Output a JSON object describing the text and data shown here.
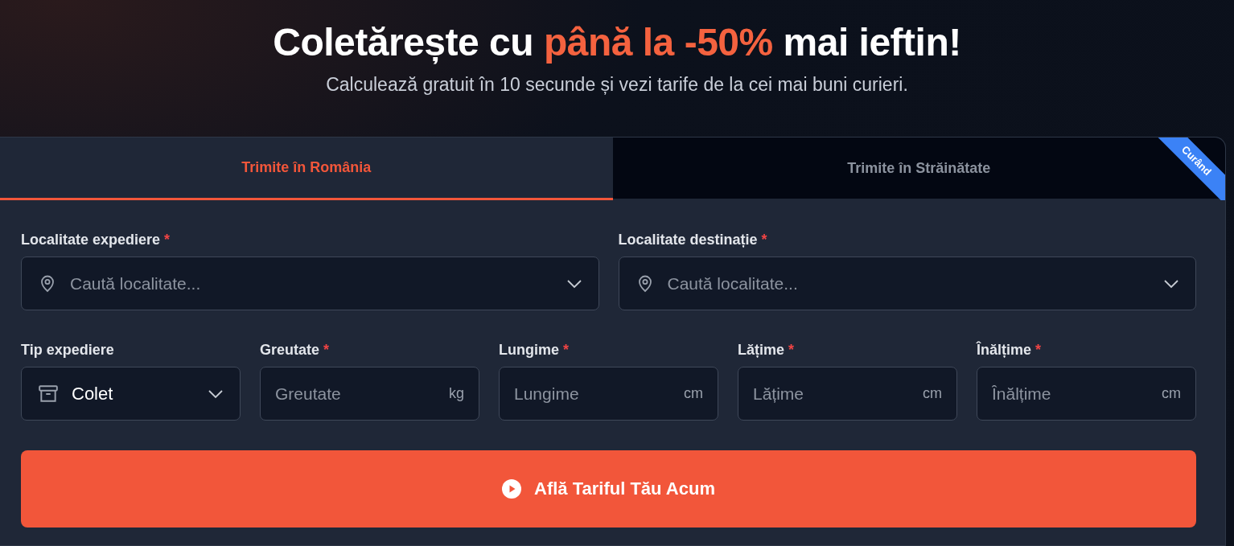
{
  "hero": {
    "title": [
      {
        "text": "Coletărește cu ",
        "highlighted": false
      },
      {
        "text": "până la -50%",
        "highlighted": true
      },
      {
        "text": " mai ieftin!",
        "highlighted": false
      }
    ],
    "subtitle": "Calculează gratuit în 10 secunde și vezi tarife de la cei mai buni curieri."
  },
  "tabs": [
    {
      "label": "Trimite în România",
      "selected": true
    },
    {
      "label": "Trimite în Străinătate",
      "selected": false,
      "ribbon": "Curând"
    }
  ],
  "rows": [
    [
      {
        "kind": "location",
        "label": "Localitate expediere",
        "required_mark": "*",
        "placeholder": "Caută localitate..."
      },
      {
        "kind": "location",
        "label": "Localitate destinație",
        "required_mark": "*",
        "placeholder": "Caută localitate..."
      }
    ],
    [
      {
        "kind": "select",
        "label": "Tip expediere",
        "value": "Colet"
      },
      {
        "kind": "number",
        "label": "Greutate",
        "required_mark": "*",
        "placeholder": "Greutate",
        "unit": "kg"
      },
      {
        "kind": "number",
        "label": "Lungime",
        "required_mark": "*",
        "placeholder": "Lungime",
        "unit": "cm"
      },
      {
        "kind": "number",
        "label": "Lățime",
        "required_mark": "*",
        "placeholder": "Lățime",
        "unit": "cm"
      },
      {
        "kind": "number",
        "label": "Înălțime",
        "required_mark": "*",
        "placeholder": "Înălțime",
        "unit": "cm"
      }
    ]
  ],
  "submit": {
    "label": "Află Tariful Tău Acum"
  }
}
